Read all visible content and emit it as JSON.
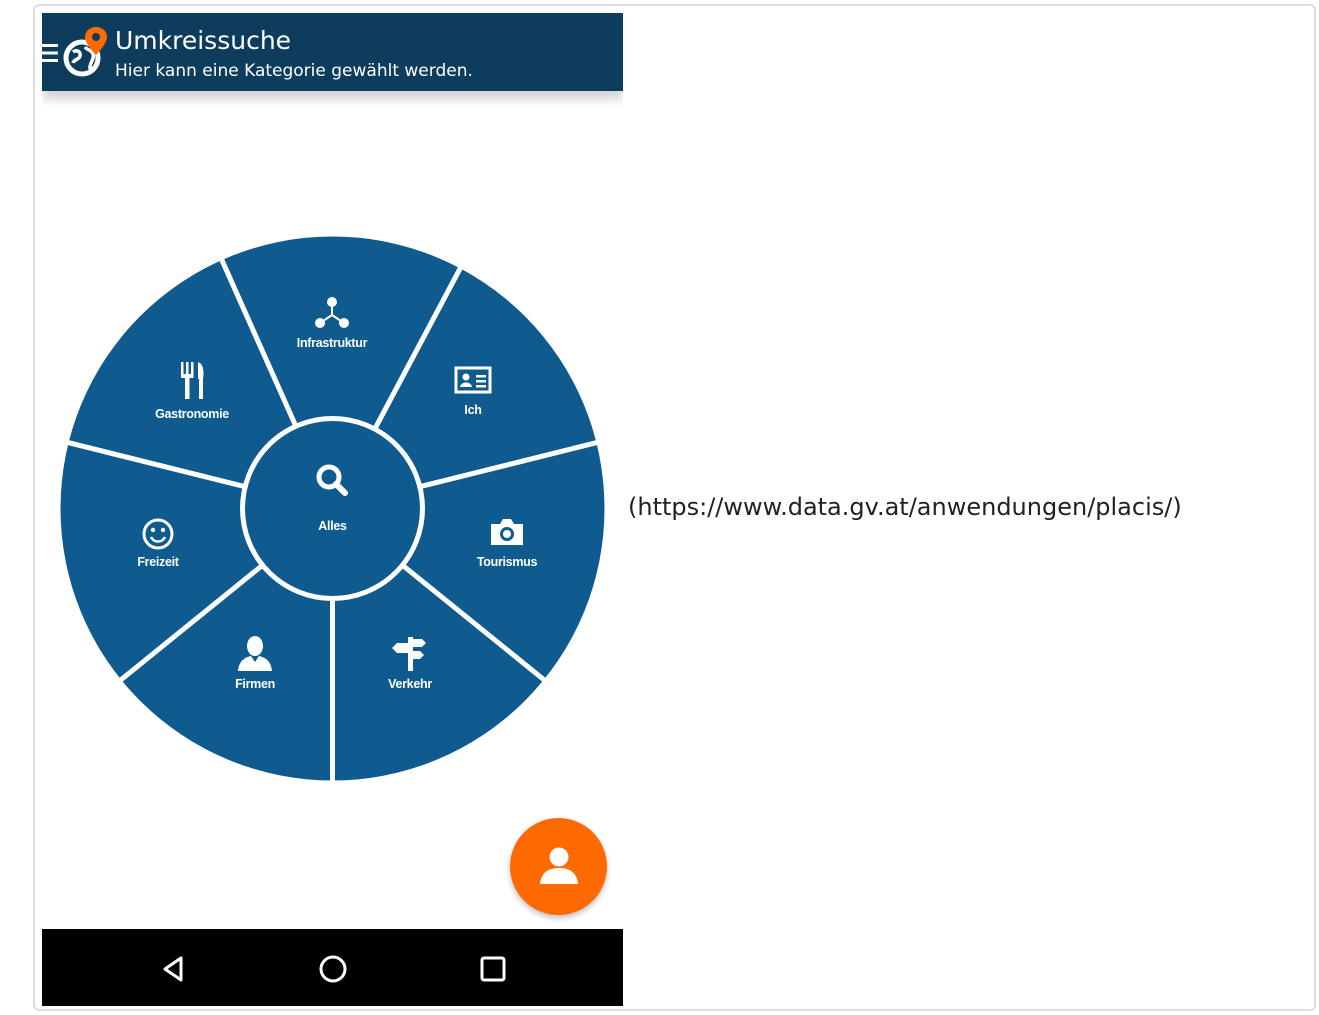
{
  "header": {
    "title": "Umkreissuche",
    "subtitle": "Hier kann eine Kategorie gewählt werden."
  },
  "wheel": {
    "center_label": "Alles",
    "center_icon": "search-icon",
    "segments": [
      {
        "label": "Infrastruktur",
        "icon": "network-icon"
      },
      {
        "label": "Ich",
        "icon": "id-card-icon"
      },
      {
        "label": "Tourismus",
        "icon": "camera-icon"
      },
      {
        "label": "Verkehr",
        "icon": "signpost-icon"
      },
      {
        "label": "Firmen",
        "icon": "person-icon"
      },
      {
        "label": "Freizeit",
        "icon": "smiley-icon"
      },
      {
        "label": "Gastronomie",
        "icon": "fork-knife-icon"
      }
    ]
  },
  "fab": {
    "icon": "user-icon"
  },
  "navbar": {
    "buttons": [
      "back-icon",
      "home-icon",
      "recent-apps-icon"
    ]
  },
  "source_link": "(https://www.data.gv.at/anwendungen/placis/)",
  "colors": {
    "appbar": "#0d3c5c",
    "wheel": "#0f5a8e",
    "fab": "#ff6a00",
    "navbar": "#000000"
  }
}
